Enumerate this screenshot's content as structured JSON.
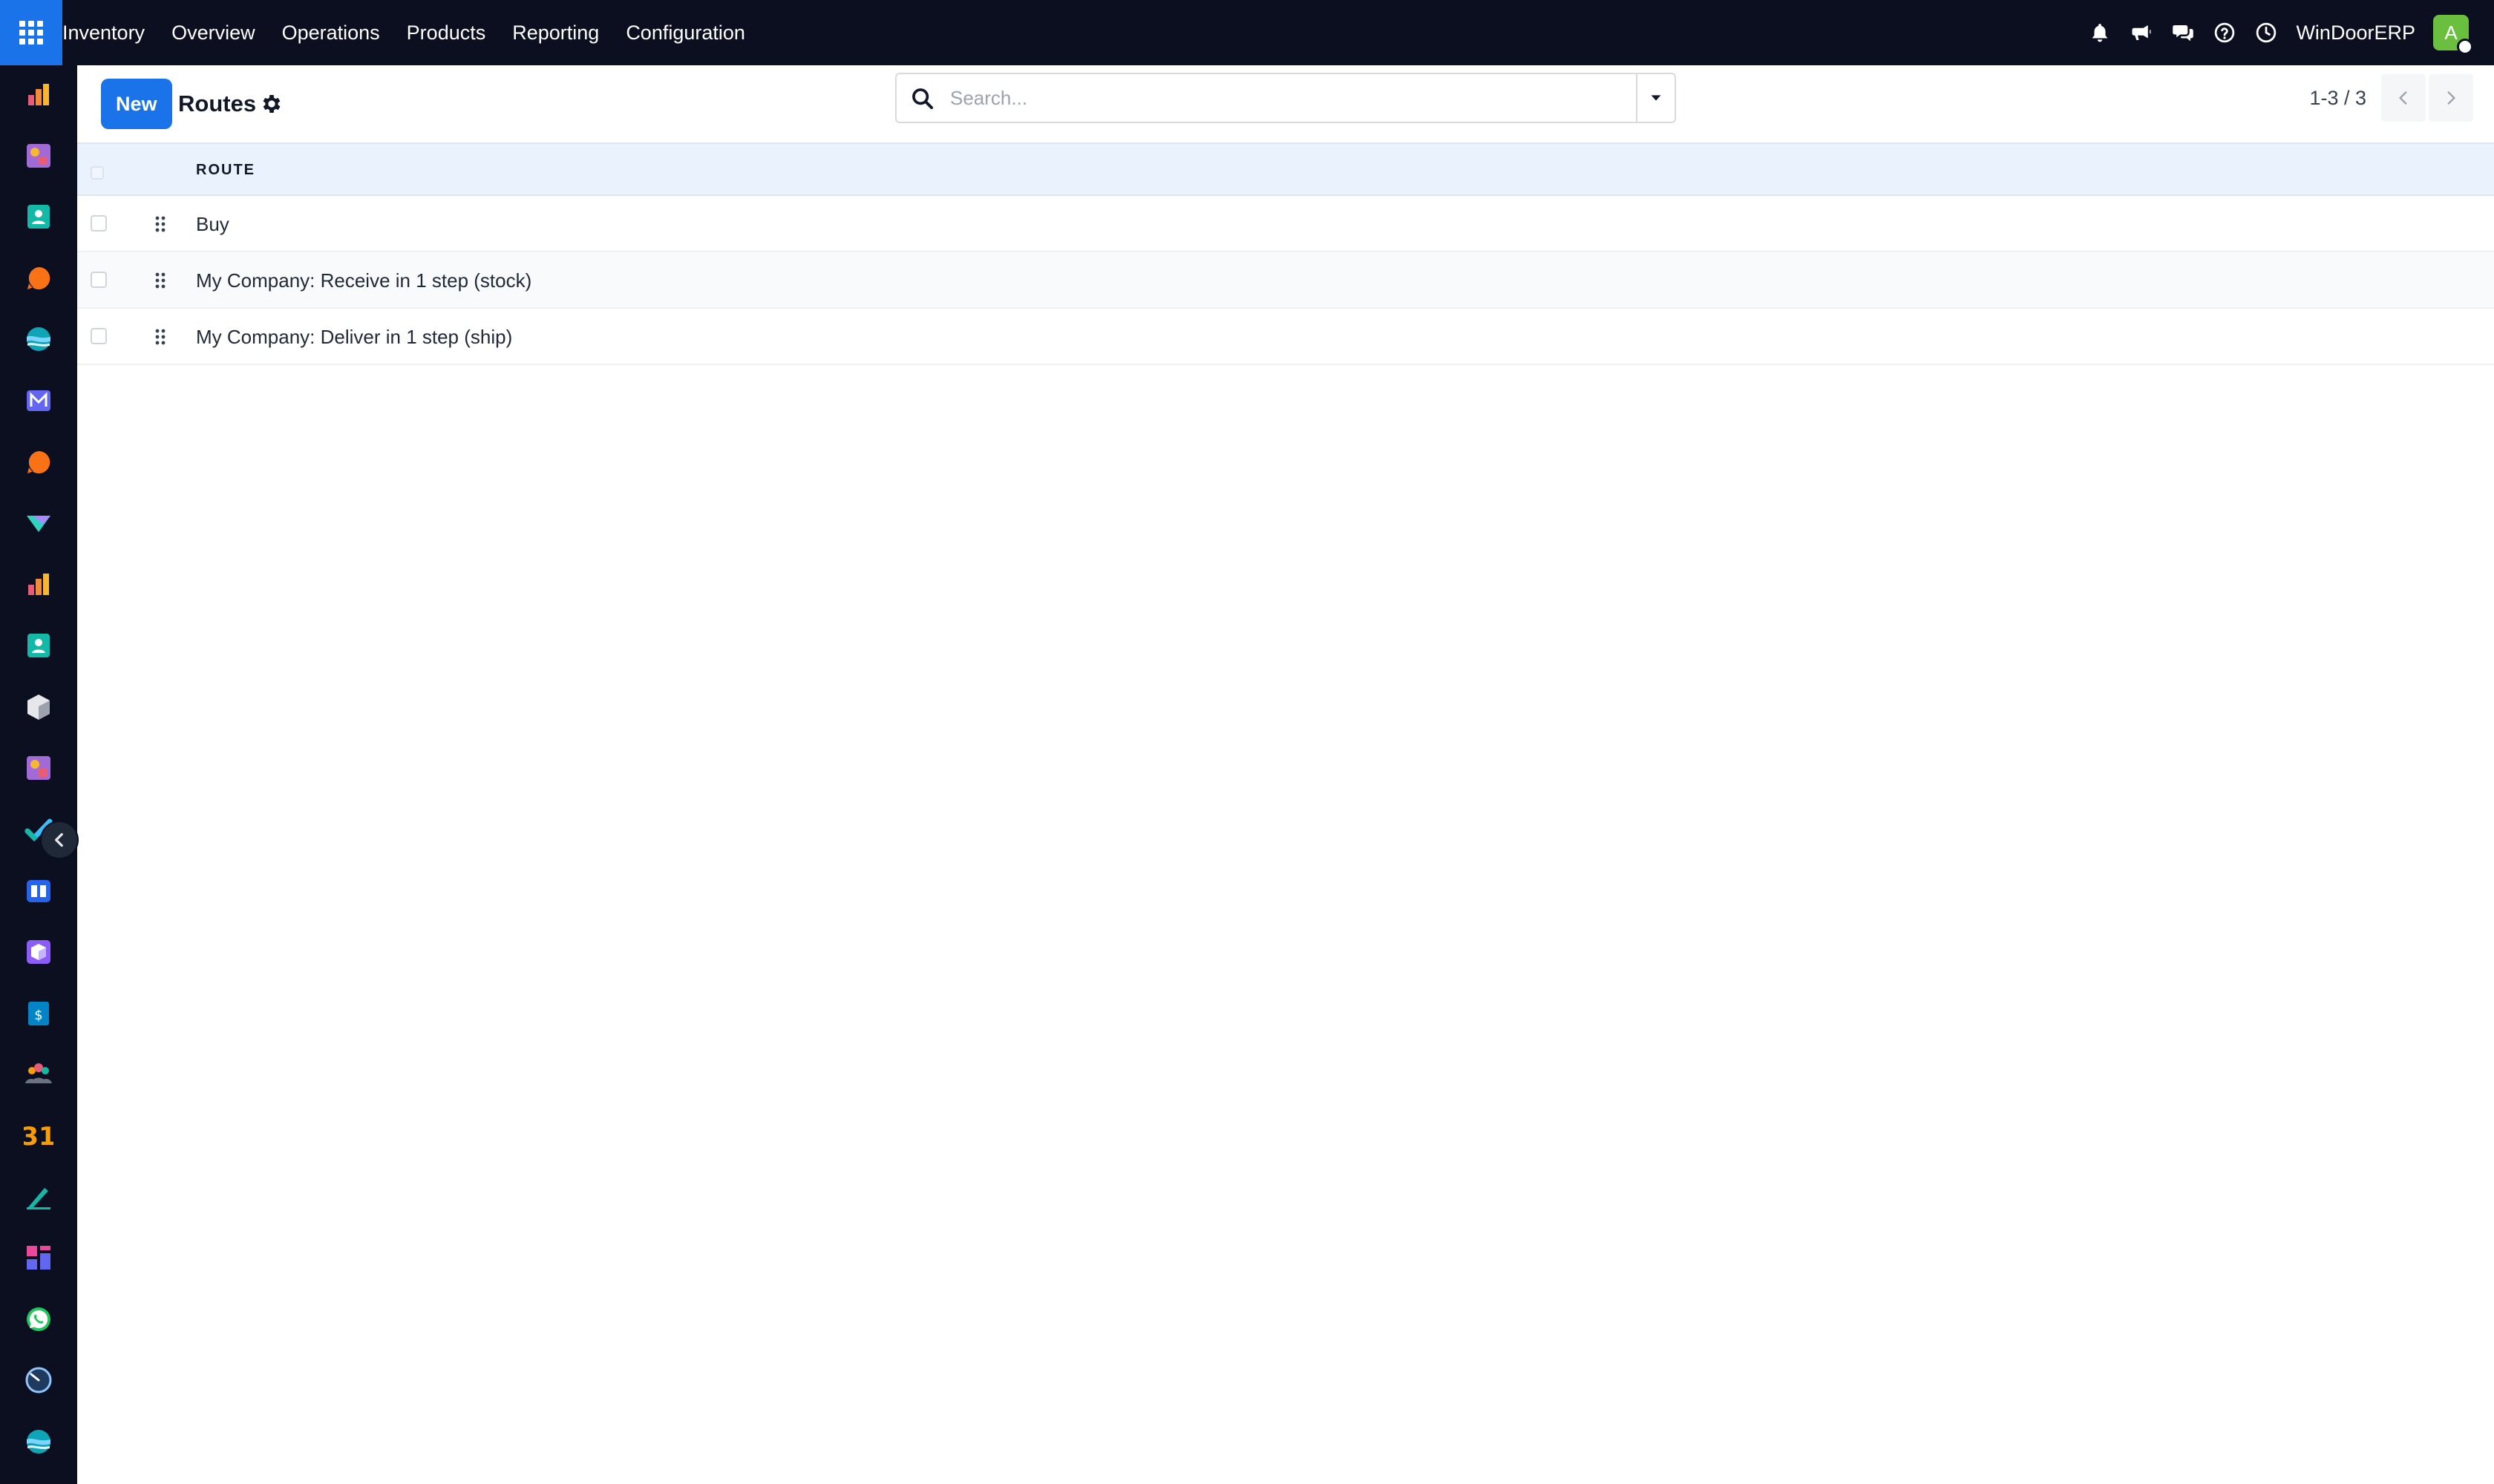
{
  "nav": {
    "app_name": "Inventory",
    "menu": [
      "Overview",
      "Operations",
      "Products",
      "Reporting",
      "Configuration"
    ],
    "company": "WinDoorERP",
    "avatar_initial": "A"
  },
  "sidebar": {
    "apps": [
      {
        "icon": "dashboard-chart-icon",
        "color": "#f28a3c"
      },
      {
        "icon": "art-palette-icon",
        "color": "#c084fc"
      },
      {
        "icon": "contacts-icon",
        "color": "#14b8a6"
      },
      {
        "icon": "discuss-bubble-icon",
        "color": "#f97316"
      },
      {
        "icon": "website-globe-icon",
        "color": "#22d3ee"
      },
      {
        "icon": "email-marketing-icon",
        "color": "#6366f1"
      },
      {
        "icon": "live-chat-bubble-icon",
        "color": "#f97316"
      },
      {
        "icon": "accounting-check-icon",
        "color": "#2dd4bf"
      },
      {
        "icon": "spreadsheet-chart-icon",
        "color": "#f28a3c"
      },
      {
        "icon": "employees-icon",
        "color": "#14b8a6"
      },
      {
        "icon": "inventory-box-icon",
        "color": "#e5e7eb"
      },
      {
        "icon": "sales-palette-icon",
        "color": "#c084fc"
      },
      {
        "icon": "project-check-icon",
        "color": "#38bdf8"
      },
      {
        "icon": "knowledge-book-icon",
        "color": "#3b82f6"
      },
      {
        "icon": "purchase-cube-icon",
        "color": "#a78bfa"
      },
      {
        "icon": "invoicing-dollar-icon",
        "color": "#0ea5e9"
      },
      {
        "icon": "team-people-icon",
        "color": "#f59e0b"
      },
      {
        "icon": "calendar-31-icon",
        "color": "#f59e0b"
      },
      {
        "icon": "sign-pen-icon",
        "color": "#14b8a6"
      },
      {
        "icon": "dashboards-tiles-icon",
        "color": "#ec4899"
      },
      {
        "icon": "whatsapp-icon",
        "color": "#22c55e"
      },
      {
        "icon": "timesheet-dial-icon",
        "color": "#60a5fa"
      },
      {
        "icon": "website-wave-icon",
        "color": "#22d3ee"
      }
    ],
    "calendar_label": "31"
  },
  "control_panel": {
    "new_label": "New",
    "title": "Routes",
    "search_placeholder": "Search...",
    "pager_value": "1-3 / 3"
  },
  "table": {
    "column_route": "ROUTE",
    "rows": [
      {
        "name": "Buy"
      },
      {
        "name": "My Company: Receive in 1 step (stock)"
      },
      {
        "name": "My Company: Deliver in 1 step (ship)"
      }
    ]
  },
  "colors": {
    "topbar": "#0b0f1f",
    "primary": "#1a73e8",
    "header_row": "#eaf2fd",
    "avatar": "#6bbf3f"
  }
}
